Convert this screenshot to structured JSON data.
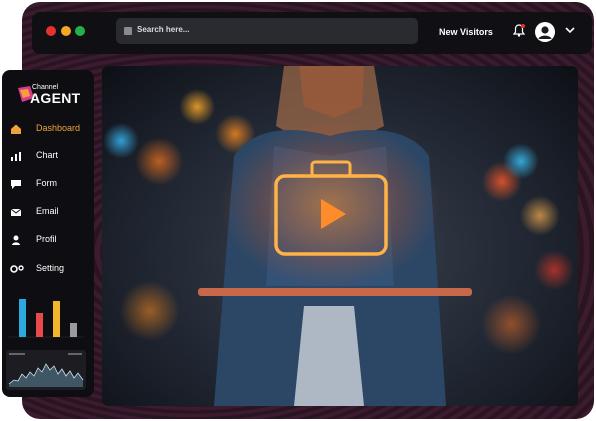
{
  "header": {
    "search_placeholder": "Search here...",
    "new_visitors_label": "New Visitors",
    "icons": [
      "bell-icon",
      "user-avatar-icon",
      "chevron-down-icon"
    ],
    "window_dots": [
      "#e5322d",
      "#f5a623",
      "#22b14c"
    ]
  },
  "logo": {
    "small": "Channel",
    "big": "AGENT",
    "accent": "#d93a8e"
  },
  "sidebar": {
    "accent": "#f0a23a",
    "items": [
      {
        "label": "Dashboard",
        "icon": "home-icon",
        "active": true
      },
      {
        "label": "Chart",
        "icon": "bar-chart-icon",
        "active": false
      },
      {
        "label": "Form",
        "icon": "form-icon",
        "active": false
      },
      {
        "label": "Email",
        "icon": "mail-icon",
        "active": false
      },
      {
        "label": "Profil",
        "icon": "user-icon",
        "active": false
      },
      {
        "label": "Setting",
        "icon": "settings-icon",
        "active": false
      }
    ]
  },
  "mini_bar_chart": {
    "colors": [
      "#2aa8e0",
      "#e84a4a",
      "#f3b52c",
      "#9a9aa3"
    ],
    "values": [
      0.95,
      0.6,
      0.9,
      0.35
    ]
  },
  "hero": {
    "icon": "video-briefcase-icon"
  }
}
